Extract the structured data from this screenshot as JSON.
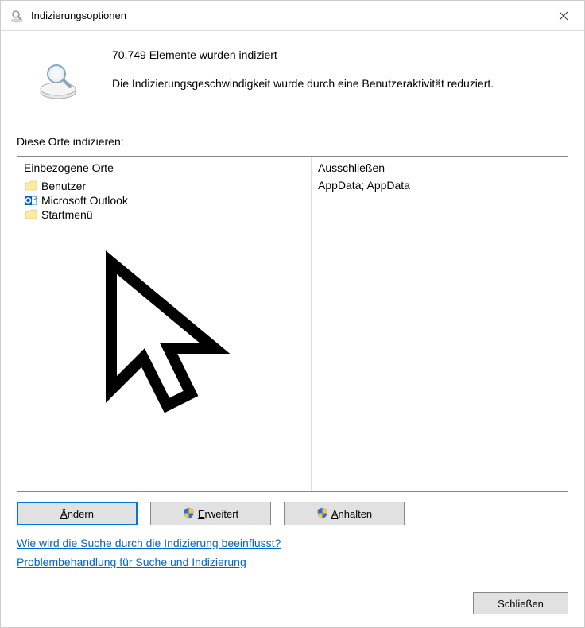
{
  "titlebar": {
    "title": "Indizierungsoptionen"
  },
  "header": {
    "count_line": "70.749 Elemente wurden indiziert",
    "status_line": "Die Indizierungsgeschwindigkeit wurde durch eine Benutzeraktivität reduziert."
  },
  "locations": {
    "label": "Diese Orte indizieren:",
    "included_header": "Einbezogene Orte",
    "excluded_header": "Ausschließen",
    "items": [
      {
        "name": "Benutzer",
        "icon": "folder",
        "exclude": "AppData; AppData"
      },
      {
        "name": "Microsoft Outlook",
        "icon": "outlook",
        "exclude": ""
      },
      {
        "name": "Startmenü",
        "icon": "folder",
        "exclude": ""
      }
    ]
  },
  "buttons": {
    "modify": "Ändern",
    "advanced": "Erweitert",
    "pause": "Anhalten",
    "close": "Schließen"
  },
  "links": {
    "help1": "Wie wird die Suche durch die Indizierung beeinflusst?",
    "help2": "Problembehandlung für Suche und Indizierung"
  }
}
